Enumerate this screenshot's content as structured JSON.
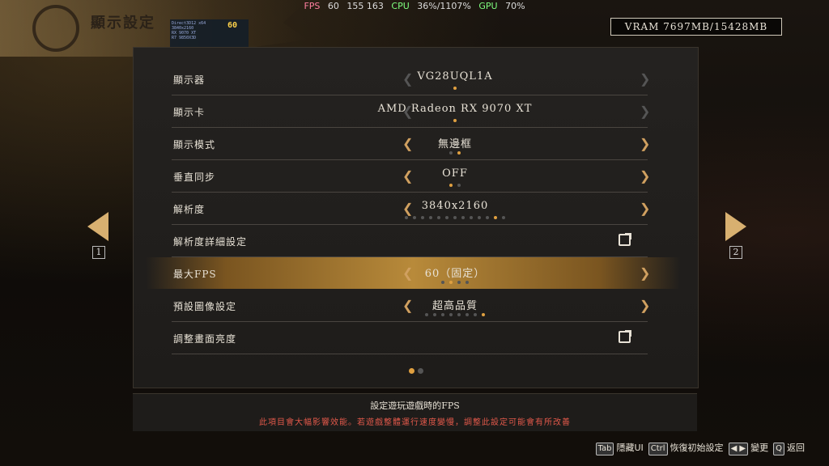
{
  "perf_overlay": {
    "fps_label": "FPS",
    "fps_value": "60",
    "frame_values": "155 163",
    "cpu_label": "CPU",
    "cpu_value": "36%/1107%",
    "gpu_label": "GPU",
    "gpu_value": "70%"
  },
  "osd": {
    "api": "Direct3D12 x64",
    "resolution": "3840x2160",
    "fps": "60",
    "gpu_name": "RX 9070 XT",
    "cpu_name": "R7 9850X3D"
  },
  "page_title": "顯示設定",
  "vram": "VRAM 7697MB/15428MB",
  "rows": [
    {
      "label": "顯示器",
      "value": "VG28UQL1A",
      "dots": 1,
      "active_dot": 0
    },
    {
      "label": "顯示卡",
      "value": "AMD Radeon RX 9070 XT",
      "dots": 1,
      "active_dot": 0
    },
    {
      "label": "顯示模式",
      "value": "無邊框",
      "dots": 2,
      "active_dot": 1
    },
    {
      "label": "垂直同步",
      "value": "OFF",
      "dots": 2,
      "active_dot": 0
    },
    {
      "label": "解析度",
      "value": "3840x2160",
      "dots": 13,
      "active_dot": 11
    },
    {
      "label": "解析度詳細設定",
      "value": ""
    },
    {
      "label": "最大FPS",
      "value": "60（固定）",
      "dots": 4,
      "active_dot": 1
    },
    {
      "label": "預設圖像設定",
      "value": "超高品質",
      "dots": 8,
      "active_dot": 7
    },
    {
      "label": "調整畫面亮度",
      "value": ""
    }
  ],
  "nav": {
    "left_key": "1",
    "right_key": "2"
  },
  "description": {
    "title": "設定遊玩遊戲時的FPS",
    "warning": "此項目會大幅影響效能。若遊戲整體運行速度變慢，調整此設定可能會有所改善"
  },
  "hints": [
    {
      "key": "Tab",
      "label": "隱藏UI"
    },
    {
      "key": "Ctrl",
      "label": "恢復初始設定"
    },
    {
      "key": "◀ ▶",
      "label": "變更"
    },
    {
      "key": "Q",
      "label": "返回"
    }
  ],
  "colors": {
    "accent": "#d0a060",
    "selected_row": "#b88a3a",
    "warning": "#e0584a"
  }
}
